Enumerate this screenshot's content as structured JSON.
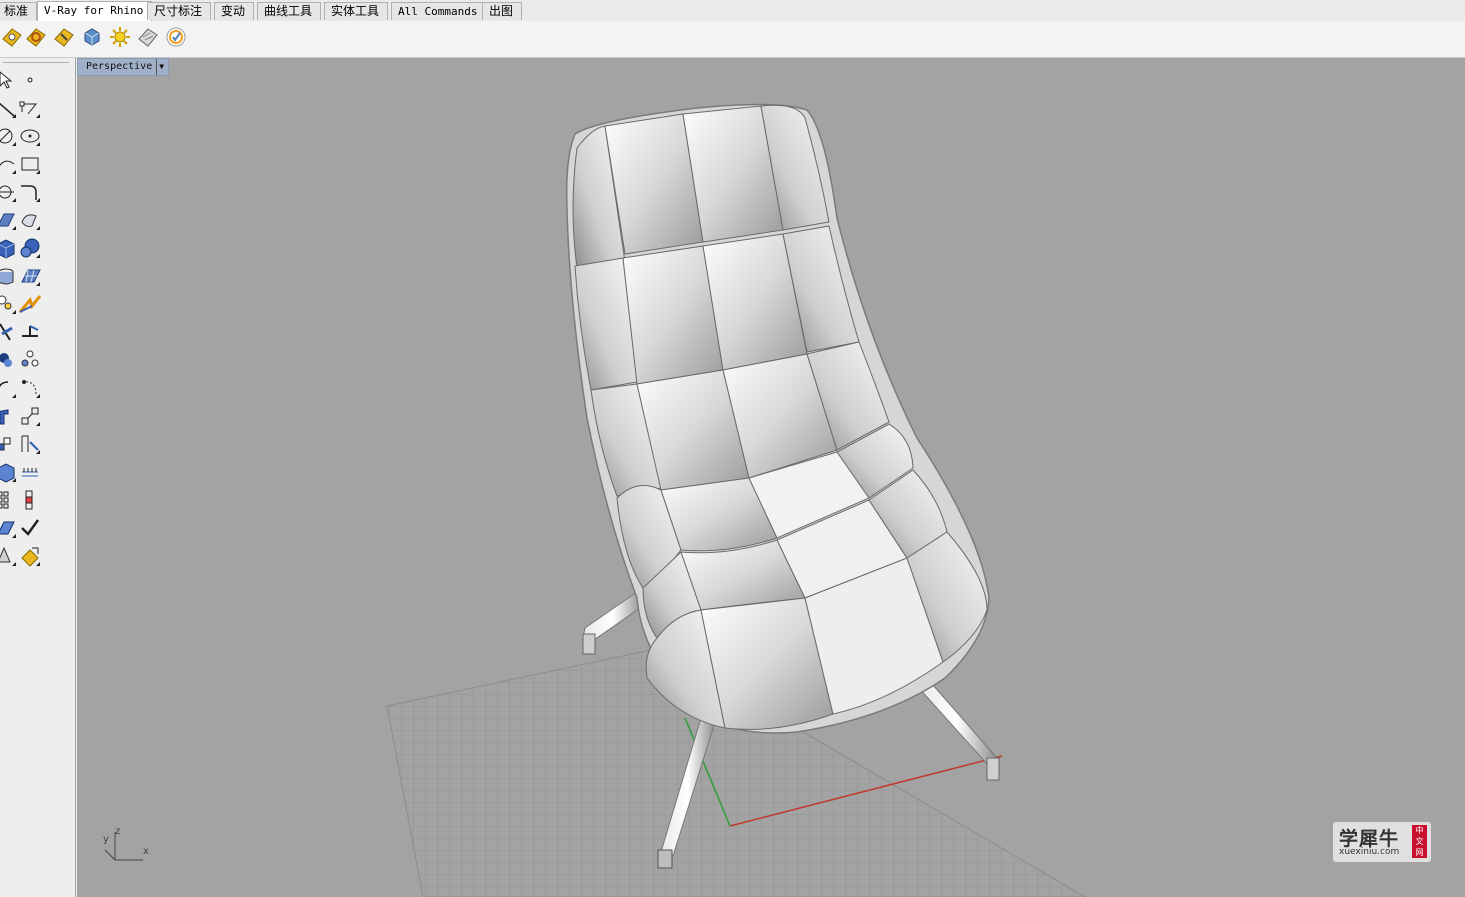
{
  "tabs": [
    {
      "label": "标准"
    },
    {
      "label": "V-Ray for Rhino"
    },
    {
      "label": "尺寸标注"
    },
    {
      "label": "变动"
    },
    {
      "label": "曲线工具"
    },
    {
      "label": "实体工具"
    },
    {
      "label": "All Commands"
    },
    {
      "label": "出图"
    }
  ],
  "active_tab": "V-Ray for Rhino",
  "toolbar_icons": [
    "vray-options-icon",
    "vray-material-editor-icon",
    "vray-render-icon",
    "vray-frame-buffer-icon",
    "vray-light-icon",
    "vray-plane-icon",
    "vray-help-icon"
  ],
  "sidebar_icons": [
    "select-icon",
    "point-icon",
    "line-icon",
    "polyline-icon",
    "circle-icon",
    "ellipse-icon",
    "arc-icon",
    "rectangle-icon",
    "curve-icon",
    "fillet-curve-icon",
    "surface-icon",
    "revolve-icon",
    "box-icon",
    "sphere-icon",
    "extrude-icon",
    "loft-icon",
    "explode-icon",
    "split-icon",
    "trim-icon",
    "boolean-icon",
    "group-icon",
    "blend-icon",
    "move-icon",
    "scale-icon",
    "copy-icon",
    "mirror-icon",
    "array-icon",
    "align-icon",
    "mesh-icon",
    "check-icon",
    "analyze-icon",
    "render-icon"
  ],
  "viewport": {
    "label": "Perspective"
  },
  "axes": {
    "y": "y",
    "z": "z",
    "x": "x"
  },
  "watermark": {
    "title": "学犀牛",
    "url": "xuexiniu.com",
    "badge": "中文网"
  },
  "colors": {
    "viewport_bg": "#a3a3a3",
    "grid": "#8c8c8c",
    "x_axis": "#c0392b",
    "y_axis": "#2e9e3a",
    "label_bg": "#9fb0c8"
  }
}
